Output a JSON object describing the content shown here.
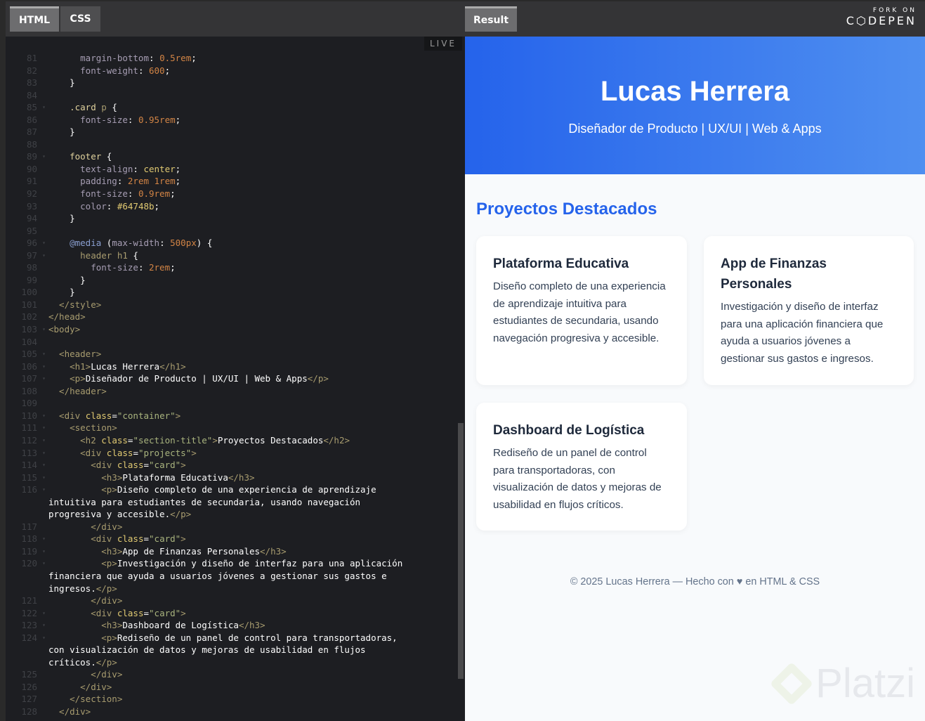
{
  "editor": {
    "tabs": [
      "HTML",
      "CSS"
    ],
    "live": "LIVE",
    "rows": [
      {
        "n": "81",
        "s": [
          [
            "c-p",
            "      margin-bottom"
          ],
          [
            "c-n",
            ": "
          ],
          [
            "c-v",
            "0.5rem"
          ],
          [
            "c-n",
            ";"
          ]
        ]
      },
      {
        "n": "82",
        "s": [
          [
            "c-p",
            "      font-weight"
          ],
          [
            "c-n",
            ": "
          ],
          [
            "c-v",
            "600"
          ],
          [
            "c-n",
            ";"
          ]
        ]
      },
      {
        "n": "83",
        "s": [
          [
            "c-n",
            "    }"
          ]
        ]
      },
      {
        "n": "84",
        "s": []
      },
      {
        "n": "85",
        "f": 1,
        "s": [
          [
            "c-s",
            "    .card "
          ],
          [
            "c-t",
            "p"
          ],
          [
            "c-n",
            " {"
          ]
        ]
      },
      {
        "n": "86",
        "s": [
          [
            "c-p",
            "      font-size"
          ],
          [
            "c-n",
            ": "
          ],
          [
            "c-v",
            "0.95rem"
          ],
          [
            "c-n",
            ";"
          ]
        ]
      },
      {
        "n": "87",
        "s": [
          [
            "c-n",
            "    }"
          ]
        ]
      },
      {
        "n": "88",
        "s": []
      },
      {
        "n": "89",
        "f": 1,
        "s": [
          [
            "c-s",
            "    footer"
          ],
          [
            "c-n",
            " {"
          ]
        ]
      },
      {
        "n": "90",
        "s": [
          [
            "c-p",
            "      text-align"
          ],
          [
            "c-n",
            ": "
          ],
          [
            "c-a",
            "center"
          ],
          [
            "c-n",
            ";"
          ]
        ]
      },
      {
        "n": "91",
        "s": [
          [
            "c-p",
            "      padding"
          ],
          [
            "c-n",
            ": "
          ],
          [
            "c-v",
            "2rem 1rem"
          ],
          [
            "c-n",
            ";"
          ]
        ]
      },
      {
        "n": "92",
        "s": [
          [
            "c-p",
            "      font-size"
          ],
          [
            "c-n",
            ": "
          ],
          [
            "c-v",
            "0.9rem"
          ],
          [
            "c-n",
            ";"
          ]
        ]
      },
      {
        "n": "93",
        "s": [
          [
            "c-p",
            "      color"
          ],
          [
            "c-n",
            ": "
          ],
          [
            "c-a",
            "#64748b"
          ],
          [
            "c-n",
            ";"
          ]
        ]
      },
      {
        "n": "94",
        "s": [
          [
            "c-n",
            "    }"
          ]
        ]
      },
      {
        "n": "95",
        "s": []
      },
      {
        "n": "96",
        "f": 1,
        "s": [
          [
            "c-k",
            "    @media"
          ],
          [
            "c-n",
            " ("
          ],
          [
            "c-p",
            "max-width"
          ],
          [
            "c-n",
            ": "
          ],
          [
            "c-v",
            "500px"
          ],
          [
            "c-n",
            ") {"
          ]
        ]
      },
      {
        "n": "97",
        "f": 1,
        "s": [
          [
            "c-t",
            "      header h1"
          ],
          [
            "c-n",
            " {"
          ]
        ]
      },
      {
        "n": "98",
        "s": [
          [
            "c-p",
            "        font-size"
          ],
          [
            "c-n",
            ": "
          ],
          [
            "c-v",
            "2rem"
          ],
          [
            "c-n",
            ";"
          ]
        ]
      },
      {
        "n": "99",
        "s": [
          [
            "c-n",
            "      }"
          ]
        ]
      },
      {
        "n": "100",
        "s": [
          [
            "c-n",
            "    }"
          ]
        ]
      },
      {
        "n": "101",
        "s": [
          [
            "c-t",
            "  </style>"
          ]
        ]
      },
      {
        "n": "102",
        "s": [
          [
            "c-t",
            "</head>"
          ]
        ]
      },
      {
        "n": "103",
        "f": 1,
        "s": [
          [
            "c-t",
            "<body>"
          ]
        ]
      },
      {
        "n": "104",
        "s": []
      },
      {
        "n": "105",
        "f": 1,
        "s": [
          [
            "c-t",
            "  <header>"
          ]
        ]
      },
      {
        "n": "106",
        "f": 1,
        "s": [
          [
            "c-t",
            "    <h1>"
          ],
          [
            "c-x",
            "Lucas Herrera"
          ],
          [
            "c-t",
            "</h1>"
          ]
        ]
      },
      {
        "n": "107",
        "f": 1,
        "s": [
          [
            "c-t",
            "    <p>"
          ],
          [
            "c-x",
            "Diseñador de Producto | UX/UI | Web & Apps"
          ],
          [
            "c-t",
            "</p>"
          ]
        ]
      },
      {
        "n": "108",
        "s": [
          [
            "c-t",
            "  </header>"
          ]
        ]
      },
      {
        "n": "109",
        "s": []
      },
      {
        "n": "110",
        "f": 1,
        "s": [
          [
            "c-t",
            "  <div "
          ],
          [
            "c-a",
            "class"
          ],
          [
            "c-n",
            "="
          ],
          [
            "c-q",
            "\"container\""
          ],
          [
            "c-t",
            ">"
          ]
        ]
      },
      {
        "n": "111",
        "f": 1,
        "s": [
          [
            "c-t",
            "    <section>"
          ]
        ]
      },
      {
        "n": "112",
        "f": 1,
        "s": [
          [
            "c-t",
            "      <h2 "
          ],
          [
            "c-a",
            "class"
          ],
          [
            "c-n",
            "="
          ],
          [
            "c-q",
            "\"section-title\""
          ],
          [
            "c-t",
            ">"
          ],
          [
            "c-x",
            "Proyectos Destacados"
          ],
          [
            "c-t",
            "</h2>"
          ]
        ]
      },
      {
        "n": "113",
        "f": 1,
        "s": [
          [
            "c-t",
            "      <div "
          ],
          [
            "c-a",
            "class"
          ],
          [
            "c-n",
            "="
          ],
          [
            "c-q",
            "\"projects\""
          ],
          [
            "c-t",
            ">"
          ]
        ]
      },
      {
        "n": "114",
        "f": 1,
        "s": [
          [
            "c-t",
            "        <div "
          ],
          [
            "c-a",
            "class"
          ],
          [
            "c-n",
            "="
          ],
          [
            "c-q",
            "\"card\""
          ],
          [
            "c-t",
            ">"
          ]
        ]
      },
      {
        "n": "115",
        "f": 1,
        "s": [
          [
            "c-t",
            "          <h3>"
          ],
          [
            "c-x",
            "Plataforma Educativa"
          ],
          [
            "c-t",
            "</h3>"
          ]
        ]
      },
      {
        "n": "116",
        "f": 1,
        "s": [
          [
            "c-t",
            "          <p>"
          ],
          [
            "c-x",
            "Diseño completo de una experiencia de aprendizaje"
          ]
        ]
      },
      {
        "n": "",
        "s": [
          [
            "c-x",
            "intuitiva para estudiantes de secundaria, usando navegación"
          ]
        ]
      },
      {
        "n": "",
        "s": [
          [
            "c-x",
            "progresiva y accesible."
          ],
          [
            "c-t",
            "</p>"
          ]
        ]
      },
      {
        "n": "117",
        "s": [
          [
            "c-t",
            "        </div>"
          ]
        ]
      },
      {
        "n": "118",
        "f": 1,
        "s": [
          [
            "c-t",
            "        <div "
          ],
          [
            "c-a",
            "class"
          ],
          [
            "c-n",
            "="
          ],
          [
            "c-q",
            "\"card\""
          ],
          [
            "c-t",
            ">"
          ]
        ]
      },
      {
        "n": "119",
        "f": 1,
        "s": [
          [
            "c-t",
            "          <h3>"
          ],
          [
            "c-x",
            "App de Finanzas Personales"
          ],
          [
            "c-t",
            "</h3>"
          ]
        ]
      },
      {
        "n": "120",
        "f": 1,
        "s": [
          [
            "c-t",
            "          <p>"
          ],
          [
            "c-x",
            "Investigación y diseño de interfaz para una aplicación"
          ]
        ]
      },
      {
        "n": "",
        "s": [
          [
            "c-x",
            "financiera que ayuda a usuarios jóvenes a gestionar sus gastos e"
          ]
        ]
      },
      {
        "n": "",
        "s": [
          [
            "c-x",
            "ingresos."
          ],
          [
            "c-t",
            "</p>"
          ]
        ]
      },
      {
        "n": "121",
        "s": [
          [
            "c-t",
            "        </div>"
          ]
        ]
      },
      {
        "n": "122",
        "f": 1,
        "s": [
          [
            "c-t",
            "        <div "
          ],
          [
            "c-a",
            "class"
          ],
          [
            "c-n",
            "="
          ],
          [
            "c-q",
            "\"card\""
          ],
          [
            "c-t",
            ">"
          ]
        ]
      },
      {
        "n": "123",
        "f": 1,
        "s": [
          [
            "c-t",
            "          <h3>"
          ],
          [
            "c-x",
            "Dashboard de Logística"
          ],
          [
            "c-t",
            "</h3>"
          ]
        ]
      },
      {
        "n": "124",
        "f": 1,
        "s": [
          [
            "c-t",
            "          <p>"
          ],
          [
            "c-x",
            "Rediseño de un panel de control para transportadoras,"
          ]
        ]
      },
      {
        "n": "",
        "s": [
          [
            "c-x",
            "con visualización de datos y mejoras de usabilidad en flujos"
          ]
        ]
      },
      {
        "n": "",
        "s": [
          [
            "c-x",
            "críticos."
          ],
          [
            "c-t",
            "</p>"
          ]
        ]
      },
      {
        "n": "125",
        "s": [
          [
            "c-t",
            "        </div>"
          ]
        ]
      },
      {
        "n": "126",
        "s": [
          [
            "c-t",
            "      </div>"
          ]
        ]
      },
      {
        "n": "127",
        "s": [
          [
            "c-t",
            "    </section>"
          ]
        ]
      },
      {
        "n": "128",
        "s": [
          [
            "c-t",
            "  </div>"
          ]
        ]
      }
    ]
  },
  "result": {
    "tab": "Result",
    "fork_small": "FORK ON",
    "fork_brand": "C⬡DEPEN"
  },
  "page": {
    "title": "Lucas Herrera",
    "subtitle": "Diseñador de Producto | UX/UI | Web & Apps",
    "section_title": "Proyectos Destacados",
    "cards": [
      {
        "title": "Plataforma Educativa",
        "text": "Diseño completo de una experiencia de aprendizaje intuitiva para estudiantes de secundaria, usando navegación progresiva y accesible."
      },
      {
        "title": "App de Finanzas Personales",
        "text": "Investigación y diseño de interfaz para una aplicación financiera que ayuda a usuarios jóvenes a gestionar sus gastos e ingresos."
      },
      {
        "title": "Dashboard de Logística",
        "text": "Rediseño de un panel de control para transportadoras, con visualización de datos y mejoras de usabilidad en flujos críticos."
      }
    ],
    "footer": "© 2025 Lucas Herrera — Hecho con ♥ en HTML & CSS"
  },
  "watermark": "Platzi"
}
